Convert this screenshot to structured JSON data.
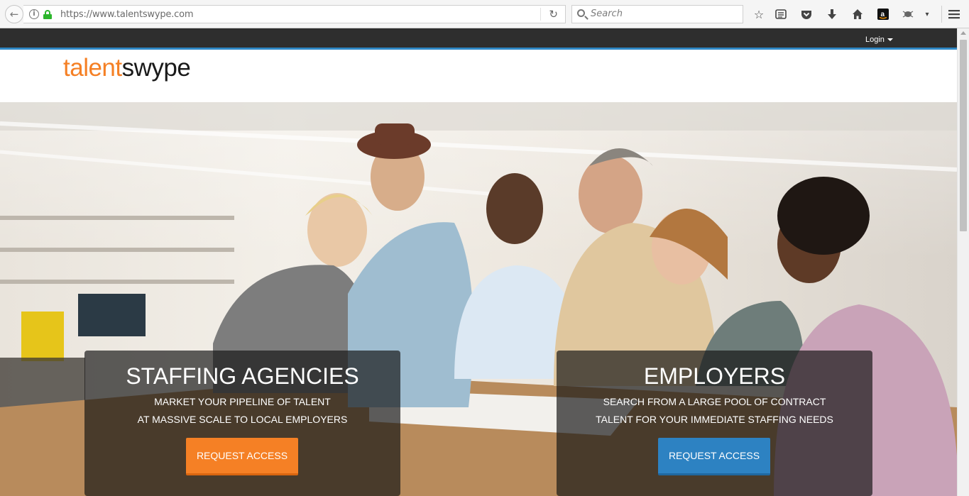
{
  "browser": {
    "url": "https://www.talentswype.com",
    "search_placeholder": "Search",
    "icons": [
      "back-arrow-icon",
      "info-icon",
      "lock-icon",
      "reload-icon",
      "search-icon",
      "bookmark-star-icon",
      "reader-list-icon",
      "pocket-icon",
      "download-icon",
      "home-icon",
      "amazon-icon",
      "extension-icon",
      "overflow-chevron-icon",
      "hamburger-menu-icon"
    ]
  },
  "nav": {
    "login_label": "Login"
  },
  "logo": {
    "part1": "talent",
    "part2": "swype"
  },
  "panels": {
    "staffing": {
      "title": "STAFFING AGENCIES",
      "line1": "MARKET YOUR PIPELINE OF TALENT",
      "line2": "AT MASSIVE SCALE TO LOCAL EMPLOYERS",
      "button": "REQUEST ACCESS"
    },
    "employers": {
      "title": "EMPLOYERS",
      "line1": "SEARCH FROM A LARGE POOL OF CONTRACT",
      "line2": "TALENT FOR YOUR IMMEDIATE STAFFING NEEDS",
      "button": "REQUEST ACCESS"
    }
  },
  "colors": {
    "brand_orange": "#f58025",
    "brand_blue": "#2d82c2",
    "nav_dark": "#2e2e2e"
  }
}
